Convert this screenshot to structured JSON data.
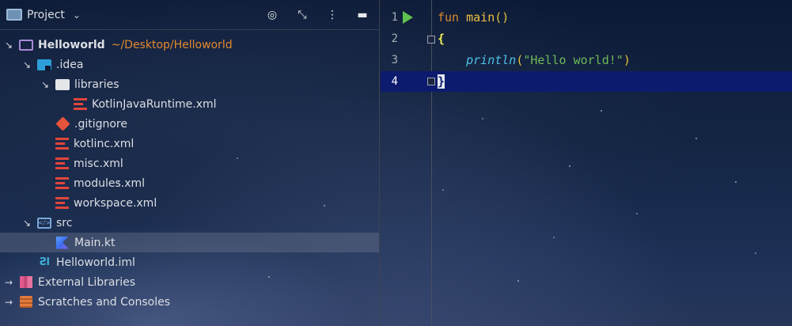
{
  "panel": {
    "title": "Project",
    "tree": [
      {
        "label": "Helloworld",
        "path": "~/Desktop/Helloworld"
      },
      {
        "label": ".idea"
      },
      {
        "label": "libraries"
      },
      {
        "label": "KotlinJavaRuntime.xml"
      },
      {
        "label": ".gitignore"
      },
      {
        "label": "kotlinc.xml"
      },
      {
        "label": "misc.xml"
      },
      {
        "label": "modules.xml"
      },
      {
        "label": "workspace.xml"
      },
      {
        "label": "src"
      },
      {
        "label": "Main.kt"
      },
      {
        "label": "Helloworld.iml"
      },
      {
        "label": "External Libraries"
      },
      {
        "label": "Scratches and Consoles"
      }
    ]
  },
  "editor": {
    "lines": [
      {
        "num": "1",
        "kw": "fun",
        "fn": "main",
        "paren": "()"
      },
      {
        "num": "2",
        "brace": "{"
      },
      {
        "num": "3",
        "call": "println",
        "open": "(",
        "str": "\"Hello world!\"",
        "close": ")"
      },
      {
        "num": "4",
        "brace": "}"
      }
    ]
  }
}
